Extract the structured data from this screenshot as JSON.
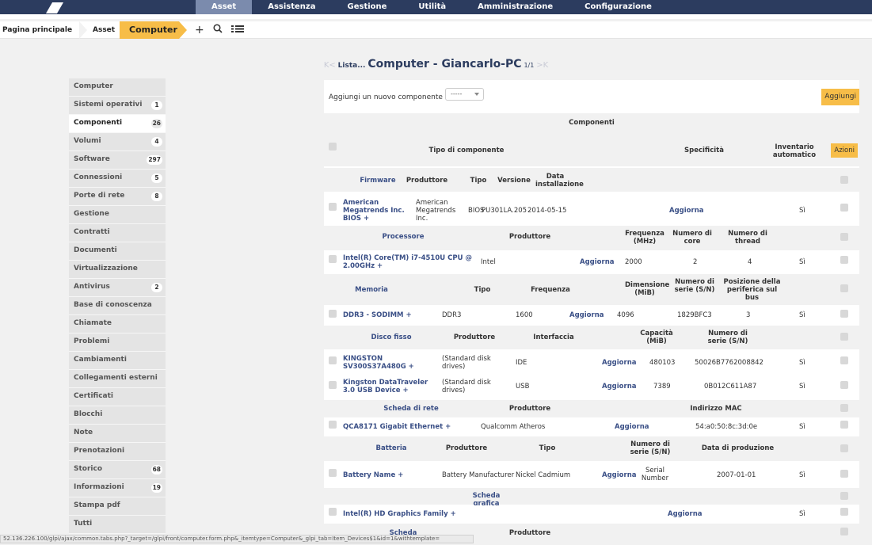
{
  "topbar": {
    "menu": [
      "Asset",
      "Assistenza",
      "Gestione",
      "Utilità",
      "Amministrazione",
      "Configurazione"
    ],
    "active_menu": "Asset"
  },
  "breadcrumb": {
    "home": "Pagina principale",
    "asset": "Asset",
    "current": "Computer",
    "icons": [
      "plus-icon",
      "search-icon",
      "list-icon"
    ]
  },
  "header": {
    "prev_nav": "K<",
    "list_link": "Lista...",
    "title": "Computer - Giancarlo-PC",
    "count": "1/1",
    "next_nav": ">K"
  },
  "sidebar": {
    "items": [
      {
        "label": "Computer",
        "badge": ""
      },
      {
        "label": "Sistemi operativi",
        "badge": "1"
      },
      {
        "label": "Componenti",
        "badge": "26"
      },
      {
        "label": "Volumi",
        "badge": "4"
      },
      {
        "label": "Software",
        "badge": "297"
      },
      {
        "label": "Connessioni",
        "badge": "5"
      },
      {
        "label": "Porte di rete",
        "badge": "8"
      },
      {
        "label": "Gestione",
        "badge": ""
      },
      {
        "label": "Contratti",
        "badge": ""
      },
      {
        "label": "Documenti",
        "badge": ""
      },
      {
        "label": "Virtualizzazione",
        "badge": ""
      },
      {
        "label": "Antivirus",
        "badge": "2"
      },
      {
        "label": "Base di conoscenza",
        "badge": ""
      },
      {
        "label": "Chiamate",
        "badge": ""
      },
      {
        "label": "Problemi",
        "badge": ""
      },
      {
        "label": "Cambiamenti",
        "badge": ""
      },
      {
        "label": "Collegamenti esterni",
        "badge": ""
      },
      {
        "label": "Certificati",
        "badge": ""
      },
      {
        "label": "Blocchi",
        "badge": ""
      },
      {
        "label": "Note",
        "badge": ""
      },
      {
        "label": "Prenotazioni",
        "badge": ""
      },
      {
        "label": "Storico",
        "badge": "68"
      },
      {
        "label": "Informazioni sull'imp...",
        "badge": "19"
      },
      {
        "label": "Stampa pdf",
        "badge": ""
      },
      {
        "label": "Tutti",
        "badge": ""
      }
    ],
    "active_index": 2
  },
  "main": {
    "add_label": "Aggiungi un nuovo componente",
    "dropdown_value": "-----",
    "add_button": "Aggiungi",
    "table_title": "Componenti",
    "col_tipo": "Tipo di componente",
    "col_spec": "Specificità",
    "col_inv": "Inventario automatico",
    "col_azioni": "Azioni",
    "firmware": {
      "hdr": [
        "Firmware",
        "Produttore",
        "Tipo",
        "Versione",
        "Data installazione"
      ],
      "name": "American Megatrends Inc. BIOS +",
      "manufacturer": "American Megatrends Inc.",
      "type": "BIOS",
      "version": "PU301LA.205",
      "date": "2014-05-15",
      "update": "Aggiorna",
      "auto": "Sì"
    },
    "processor": {
      "hdr": [
        "Processore",
        "Produttore",
        "Frequenza (MHz)",
        "Numero di core",
        "Numero di thread"
      ],
      "name": "Intel(R) Core(TM) i7-4510U CPU @ 2.00GHz +",
      "manufacturer": "Intel",
      "update": "Aggiorna",
      "freq": "2000",
      "cores": "2",
      "threads": "4",
      "auto": "Sì"
    },
    "memory": {
      "hdr": [
        "Memoria",
        "Tipo",
        "Frequenza",
        "Dimensione (MiB)",
        "Numero di serie (S/N)",
        "Posizione della periferica sul bus"
      ],
      "name": "DDR3 - SODIMM +",
      "type": "DDR3",
      "freq": "1600",
      "update": "Aggiorna",
      "size": "4096",
      "serial": "1829BFC3",
      "pos": "3",
      "auto": "Sì"
    },
    "disk": {
      "hdr": [
        "Disco fisso",
        "Produttore",
        "Interfaccia",
        "Capacità (MiB)",
        "Numero di serie (S/N)"
      ],
      "rows": [
        {
          "name": "KINGSTON SV300S37A480G +",
          "manufacturer": "(Standard disk drives)",
          "iface": "IDE",
          "update": "Aggiorna",
          "capacity": "480103",
          "serial": "50026B7762008842",
          "auto": "Sì"
        },
        {
          "name": "Kingston DataTraveler 3.0 USB Device +",
          "manufacturer": "(Standard disk drives)",
          "iface": "USB",
          "update": "Aggiorna",
          "capacity": "7389",
          "serial": "0B012C611A87",
          "auto": "Sì"
        }
      ]
    },
    "network": {
      "hdr": [
        "Scheda di rete",
        "Produttore",
        "Indirizzo MAC"
      ],
      "name": "QCA8171 Gigabit Ethernet +",
      "manufacturer": "Qualcomm Atheros",
      "update": "Aggiorna",
      "mac": "54:a0:50:8c:3d:0e",
      "auto": "Sì"
    },
    "battery": {
      "hdr": [
        "Batteria",
        "Produttore",
        "Tipo",
        "Numero di serie (S/N)",
        "Data di produzione"
      ],
      "name": "Battery Name +",
      "manufacturer": "Battery Manufacturer",
      "type": "Nickel Cadmium",
      "update": "Aggiorna",
      "serial": "Serial Number",
      "date": "2007-01-01",
      "auto": "Sì"
    },
    "graphics": {
      "hdr": "Scheda grafica",
      "name": "Intel(R) HD Graphics Family +",
      "update": "Aggiorna",
      "auto": "Sì"
    },
    "sound": {
      "hdr": [
        "Scheda audio",
        "Produttore"
      ]
    }
  },
  "status": {
    "url": "52.136.226.100/glpi/ajax/common.tabs.php?_target=/glpi/front/computer.form.php&_itemtype=Computer&_glpi_tab=Item_Devices$1&id=1&withtemplate="
  }
}
